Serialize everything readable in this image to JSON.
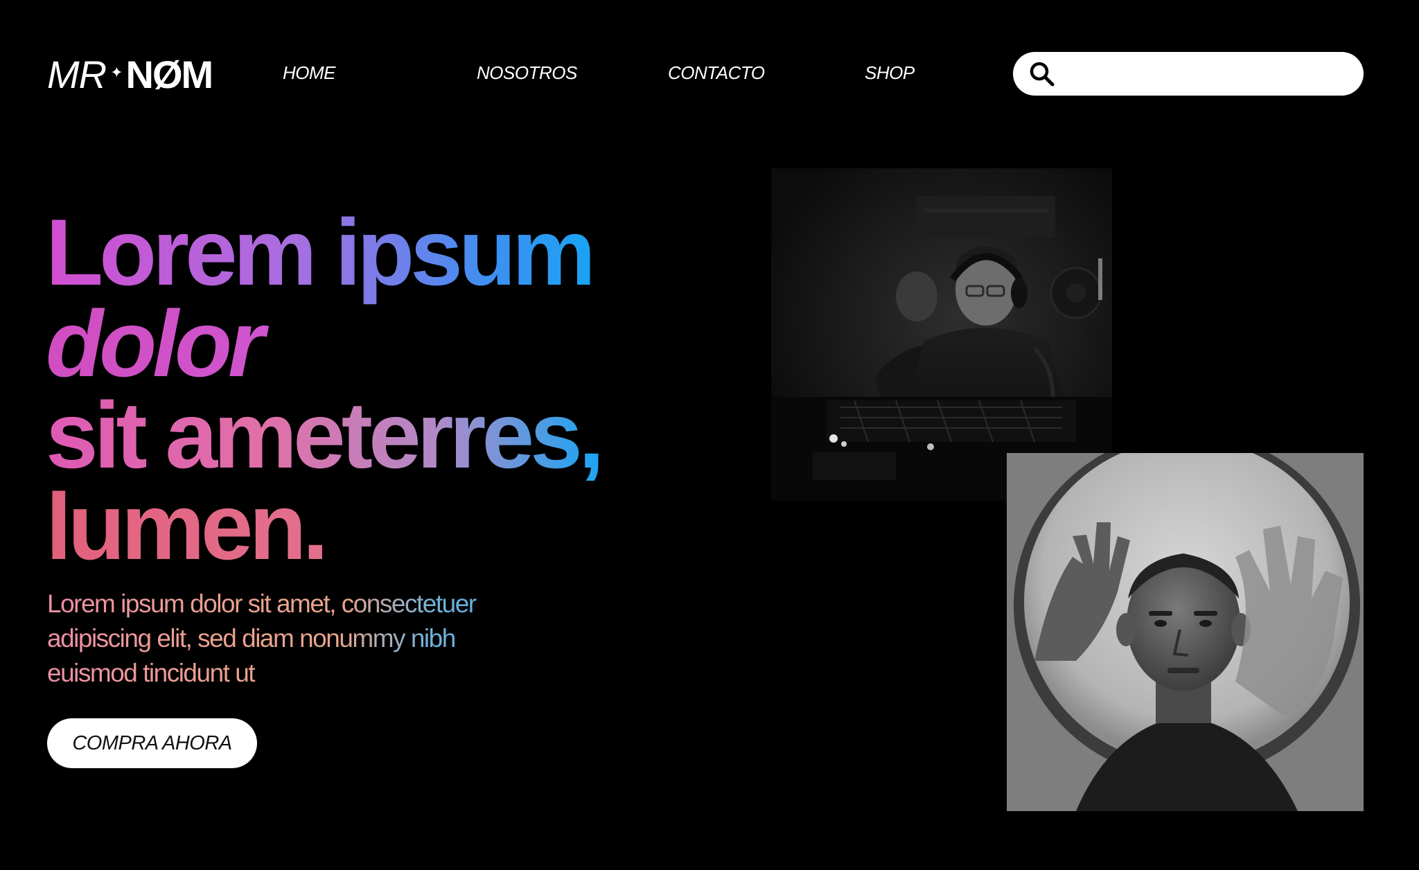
{
  "header": {
    "logo": {
      "light": "MR",
      "separator": "✦",
      "bold": "NØM"
    },
    "nav": [
      {
        "label": "HOME"
      },
      {
        "label": "NOSOTROS"
      },
      {
        "label": "CONTACTO"
      },
      {
        "label": "SHOP"
      }
    ],
    "search": {
      "icon": "search-icon",
      "value": "",
      "placeholder": ""
    }
  },
  "hero": {
    "headline": {
      "line1": "Lorem ipsum",
      "line2": "dolor",
      "line3": "sit ameterres,",
      "line4": "lumen."
    },
    "body": "Lorem ipsum dolor sit amet, consectetuer adipiscing elit, sed diam nonummy nibh euismod tincidunt ut",
    "cta_label": "COMPRA AHORA"
  },
  "colors": {
    "background": "#000000",
    "text": "#ffffff",
    "gradient_magenta": "#d24ed0",
    "gradient_blue": "#17a4f4",
    "gradient_pink": "#e1607c"
  }
}
